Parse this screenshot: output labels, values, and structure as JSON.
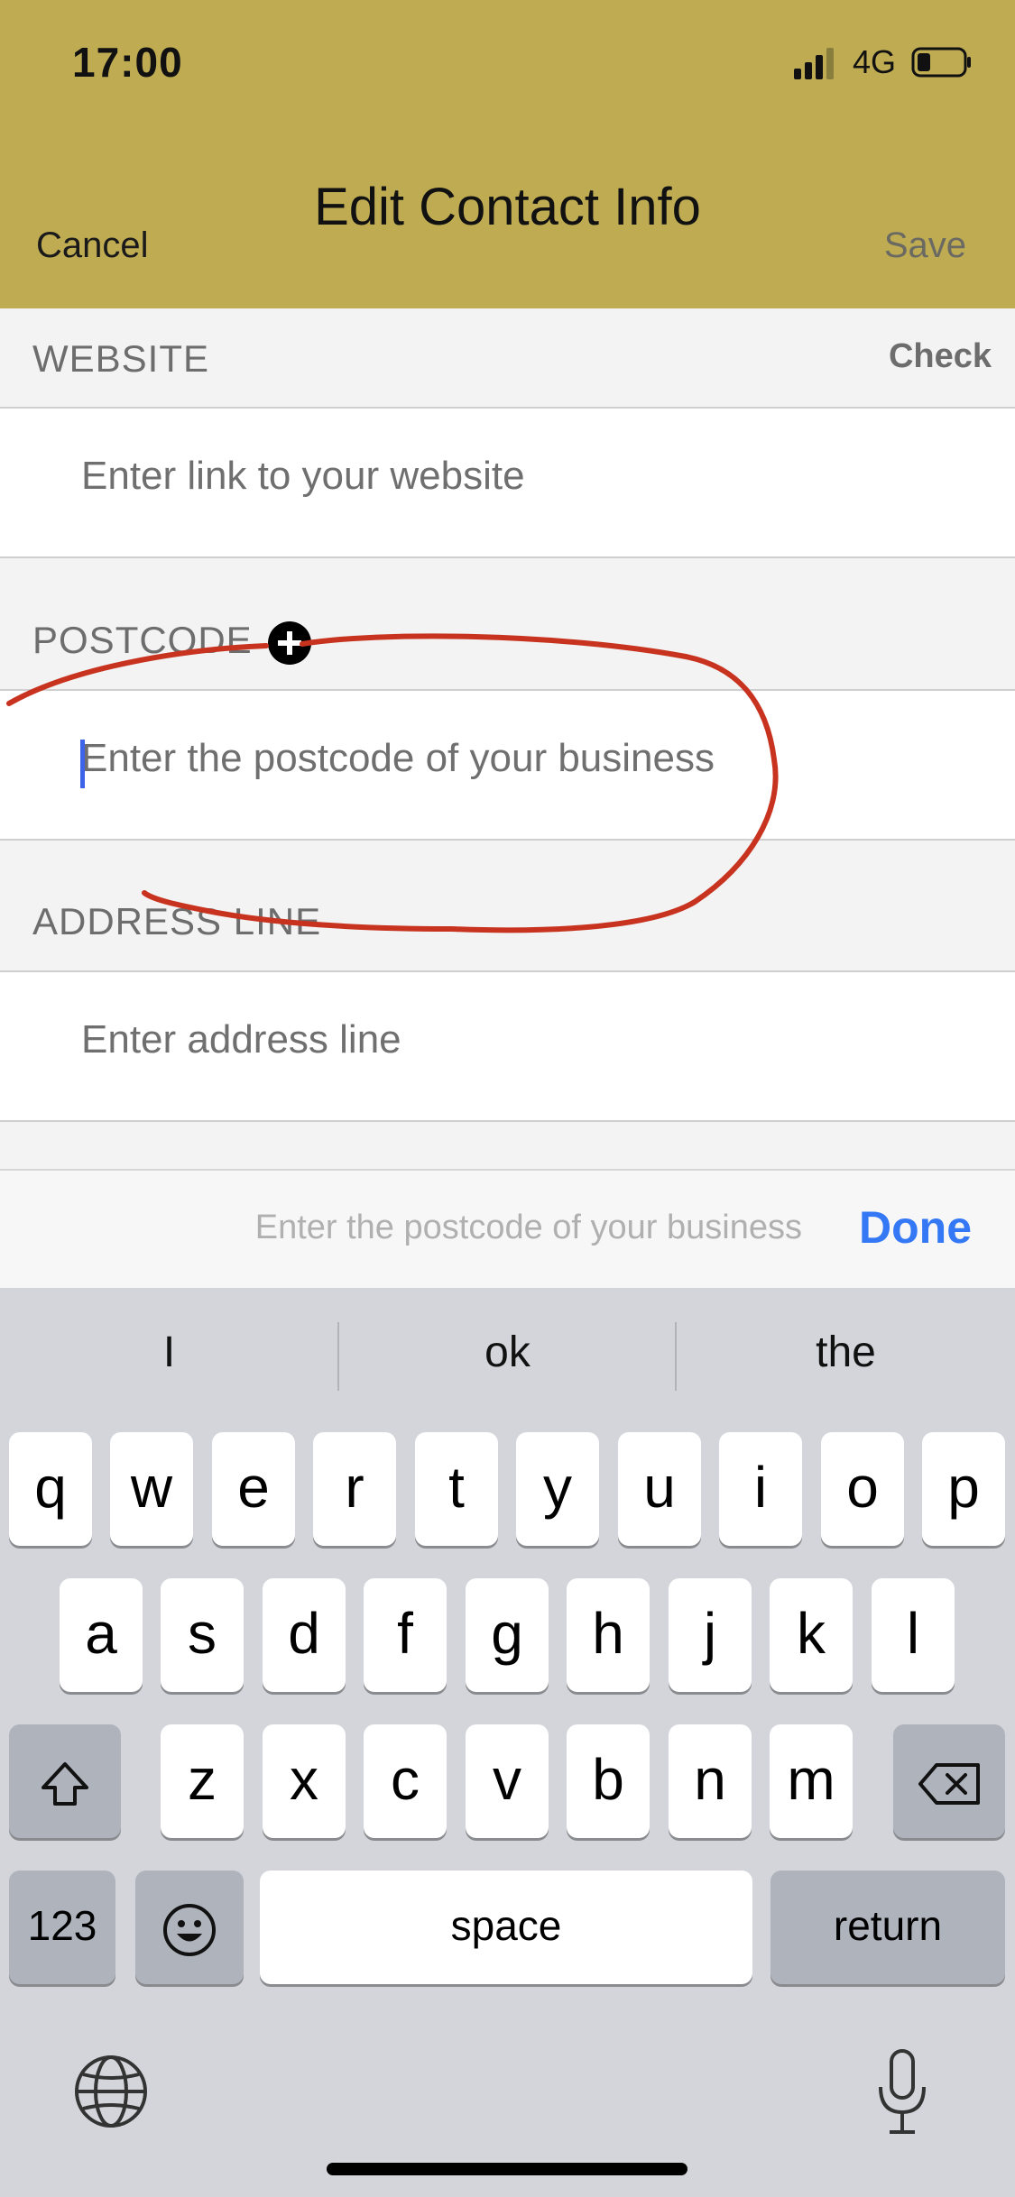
{
  "status_bar": {
    "time": "17:00",
    "network": "4G"
  },
  "nav": {
    "title": "Edit Contact Info",
    "cancel": "Cancel",
    "save": "Save"
  },
  "website": {
    "label": "WEBSITE",
    "check": "Check",
    "placeholder": "Enter link to your website"
  },
  "postcode": {
    "label": "POSTCODE",
    "placeholder": "Enter the postcode of your business"
  },
  "address": {
    "label": "ADDRESS LINE",
    "placeholder": "Enter address line"
  },
  "accessory": {
    "hint": "Enter the postcode of your business",
    "done": "Done"
  },
  "suggestions": [
    "I",
    "ok",
    "the"
  ],
  "keyboard": {
    "row1": [
      "q",
      "w",
      "e",
      "r",
      "t",
      "y",
      "u",
      "i",
      "o",
      "p"
    ],
    "row2": [
      "a",
      "s",
      "d",
      "f",
      "g",
      "h",
      "j",
      "k",
      "l"
    ],
    "row3": [
      "z",
      "x",
      "c",
      "v",
      "b",
      "n",
      "m"
    ],
    "numbers": "123",
    "space": "space",
    "return": "return"
  },
  "annotation_color": "#c8331f",
  "accent_color": "#3478f6"
}
